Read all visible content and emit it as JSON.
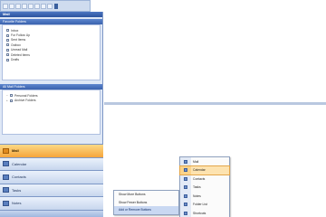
{
  "toolbar": {
    "buttons": [
      "new-icon",
      "open-icon",
      "save-icon",
      "back-icon",
      "forward-icon",
      "print-icon",
      "search-icon",
      "settings-icon"
    ]
  },
  "nav": {
    "header": "Mail",
    "favorites_title": "Favorite Folders",
    "favorites": [
      "Inbox",
      "For Follow Up",
      "Sent Items",
      "Outbox",
      "Unread Mail",
      "Deleted Items",
      "Drafts"
    ],
    "all_folders_title": "All Mail Folders",
    "all_folders": [
      {
        "label": "Personal Folders",
        "expander": "–"
      },
      {
        "label": "Archive Folders",
        "expander": "+"
      }
    ],
    "buttons": [
      "Mail",
      "Calendar",
      "Contacts",
      "Tasks",
      "Notes"
    ],
    "active_button": "Mail"
  },
  "context_menu": {
    "items": [
      "Show More Buttons",
      "Show Fewer Buttons",
      "Add or Remove Buttons"
    ],
    "highlighted": "Add or Remove Buttons"
  },
  "submenu": {
    "items": [
      "Mail",
      "Calendar",
      "Contacts",
      "Tasks",
      "Notes",
      "Folder List",
      "Shortcuts"
    ],
    "highlighted": "Calendar"
  }
}
